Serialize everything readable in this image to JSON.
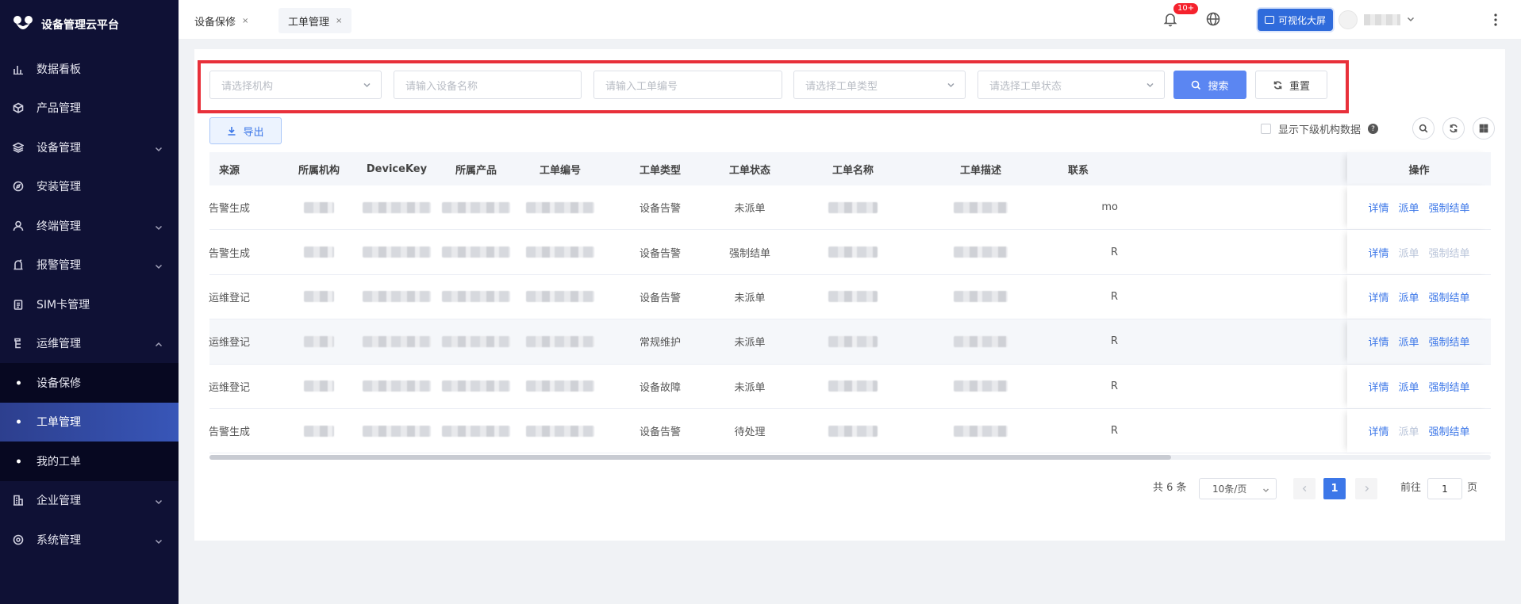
{
  "app": {
    "title": "设备管理云平台"
  },
  "sidebar": {
    "items": [
      {
        "label": "数据看板",
        "icon": "bar-chart-icon",
        "has_children": false
      },
      {
        "label": "产品管理",
        "icon": "cube-icon",
        "has_children": false
      },
      {
        "label": "设备管理",
        "icon": "layers-icon",
        "has_children": true
      },
      {
        "label": "安装管理",
        "icon": "compass-icon",
        "has_children": false
      },
      {
        "label": "终端管理",
        "icon": "user-icon",
        "has_children": true
      },
      {
        "label": "报警管理",
        "icon": "alarm-icon",
        "has_children": true
      },
      {
        "label": "SIM卡管理",
        "icon": "clipboard-icon",
        "has_children": false
      },
      {
        "label": "运维管理",
        "icon": "tools-icon",
        "has_children": true,
        "expanded": true
      }
    ],
    "sub_items": [
      {
        "label": "设备保修",
        "active": false
      },
      {
        "label": "工单管理",
        "active": true
      },
      {
        "label": "我的工单",
        "active": false
      }
    ],
    "bottom_items": [
      {
        "label": "企业管理",
        "icon": "building-icon",
        "has_children": true
      },
      {
        "label": "系统管理",
        "icon": "settings-icon",
        "has_children": true
      }
    ]
  },
  "tabs": [
    {
      "label": "设备保修",
      "close": "×",
      "active": false
    },
    {
      "label": "工单管理",
      "close": "×",
      "active": true
    }
  ],
  "header": {
    "notification_count": "10+",
    "visual_screen_label": "可视化大屏"
  },
  "filters": {
    "org_placeholder": "请选择机构",
    "device_name_placeholder": "请输入设备名称",
    "order_no_placeholder": "请输入工单编号",
    "order_type_placeholder": "请选择工单类型",
    "order_status_placeholder": "请选择工单状态",
    "search_label": "搜索",
    "reset_label": "重置"
  },
  "toolbar": {
    "export_label": "导出",
    "show_sub_org_label": "显示下级机构数据",
    "help_glyph": "?"
  },
  "table": {
    "headers": [
      "来源",
      "所属机构",
      "DeviceKey",
      "所属产品",
      "工单编号",
      "工单类型",
      "工单状态",
      "工单名称",
      "工单描述",
      "联系",
      "操作"
    ],
    "rows": [
      {
        "source": "告警生成",
        "type": "设备告警",
        "status": "未派单",
        "contact": "mo",
        "ops": [
          "详情",
          "派单",
          "强制结单"
        ],
        "ops_disabled": [
          false,
          false,
          false
        ]
      },
      {
        "source": "告警生成",
        "type": "设备告警",
        "status": "强制结单",
        "contact": "R",
        "ops": [
          "详情",
          "派单",
          "强制结单"
        ],
        "ops_disabled": [
          false,
          true,
          true
        ]
      },
      {
        "source": "运维登记",
        "type": "设备告警",
        "status": "未派单",
        "contact": "R",
        "ops": [
          "详情",
          "派单",
          "强制结单"
        ],
        "ops_disabled": [
          false,
          false,
          false
        ]
      },
      {
        "source": "运维登记",
        "type": "常规维护",
        "status": "未派单",
        "contact": "R",
        "ops": [
          "详情",
          "派单",
          "强制结单"
        ],
        "ops_disabled": [
          false,
          false,
          false
        ]
      },
      {
        "source": "运维登记",
        "type": "设备故障",
        "status": "未派单",
        "contact": "R",
        "ops": [
          "详情",
          "派单",
          "强制结单"
        ],
        "ops_disabled": [
          false,
          false,
          false
        ]
      },
      {
        "source": "告警生成",
        "type": "设备告警",
        "status": "待处理",
        "contact": "R",
        "ops": [
          "详情",
          "派单",
          "强制结单"
        ],
        "ops_disabled": [
          false,
          true,
          false
        ]
      }
    ]
  },
  "pagination": {
    "total_text": "共 6 条",
    "page_size": "10条/页",
    "current_page": "1",
    "goto_prefix": "前往",
    "goto_value": "1",
    "goto_suffix": "页"
  },
  "colors": {
    "sidebar_bg": "#0f1135",
    "accent": "#3c77e8",
    "highlight_border": "#e8303a"
  }
}
